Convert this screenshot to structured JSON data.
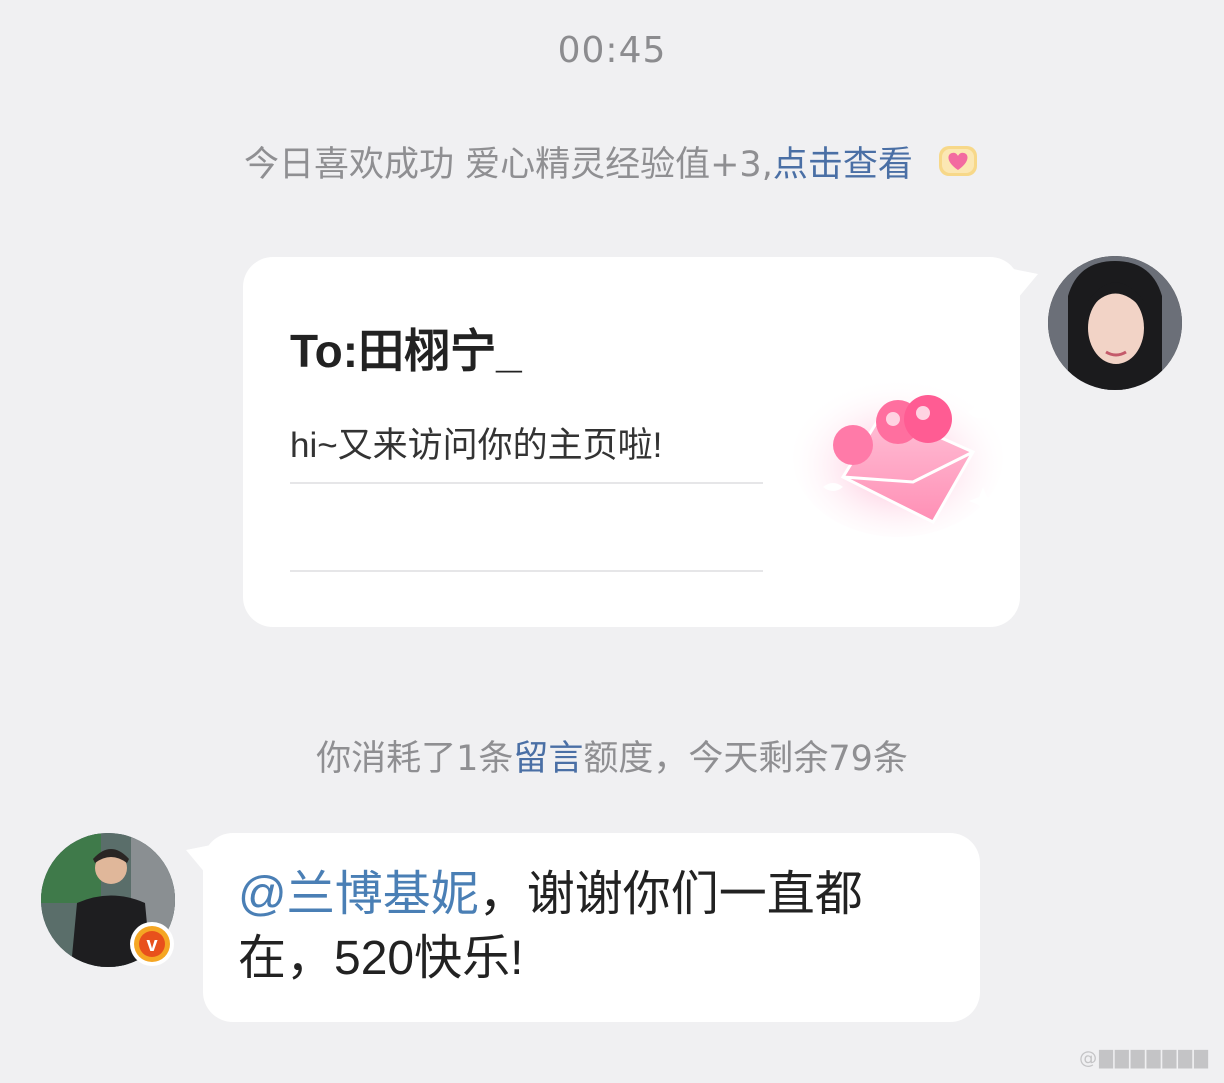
{
  "chat": {
    "timestamp": "00:45",
    "system_notice": {
      "text": "今日喜欢成功 爱心精灵经验值+3,",
      "link": "点击查看",
      "icon": "heart-badge-icon"
    },
    "gift_card": {
      "title": "To:田栩宁_",
      "message": "hi~又来访问你的主页啦!",
      "art": "love-letter-envelope-icon"
    },
    "quota_notice": {
      "prefix": "你消耗了1条",
      "link": "留言",
      "suffix": "额度，今天剩余79条"
    },
    "reply": {
      "mention": "@兰博基妮",
      "text": "，谢谢你们一直都在，520快乐!",
      "verified_badge": "v"
    },
    "watermark": "@▇▇▇▇▇▇▇"
  },
  "colors": {
    "background": "#f0f0f2",
    "link": "#4a6fa5",
    "mention": "#4a7fb5",
    "verified": "#f5a623"
  }
}
